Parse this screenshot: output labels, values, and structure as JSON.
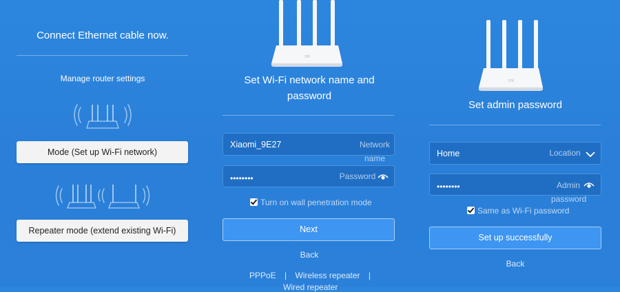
{
  "panel1": {
    "title": "Connect Ethernet cable now.",
    "subtitle": "Manage router settings",
    "mode_button": "Mode (Set up Wi-Fi network)",
    "repeater_button": "Repeater mode (extend existing Wi-Fi)"
  },
  "panel2": {
    "title_line1": "Set Wi-Fi network name and",
    "title_line2": "password",
    "network_name_value": "Xiaomi_9E27",
    "network_name_label_1": "Network",
    "network_name_label_2": "name",
    "password_value": "••••••••",
    "password_label": "Password",
    "checkbox_label": "Turn on wall penetration mode",
    "next_button": "Next",
    "back_link": "Back",
    "footer_links": [
      "PPPoE",
      "Wireless repeater",
      "Wired repeater"
    ],
    "footer_separator": "|"
  },
  "panel3": {
    "title": "Set admin password",
    "location_value": "Home",
    "location_label": "Location",
    "admin_password_value": "••••••••",
    "admin_password_label_1": "Admin",
    "admin_password_label_2": "password",
    "checkbox_label": "Same as Wi-Fi password",
    "setup_button": "Set up successfully",
    "back_link": "Back"
  },
  "router_logo": "mi",
  "icons": [
    "router-icon",
    "wifi-waves-icon",
    "eye-icon",
    "chevron-down-icon",
    "checkbox-checked-icon"
  ]
}
